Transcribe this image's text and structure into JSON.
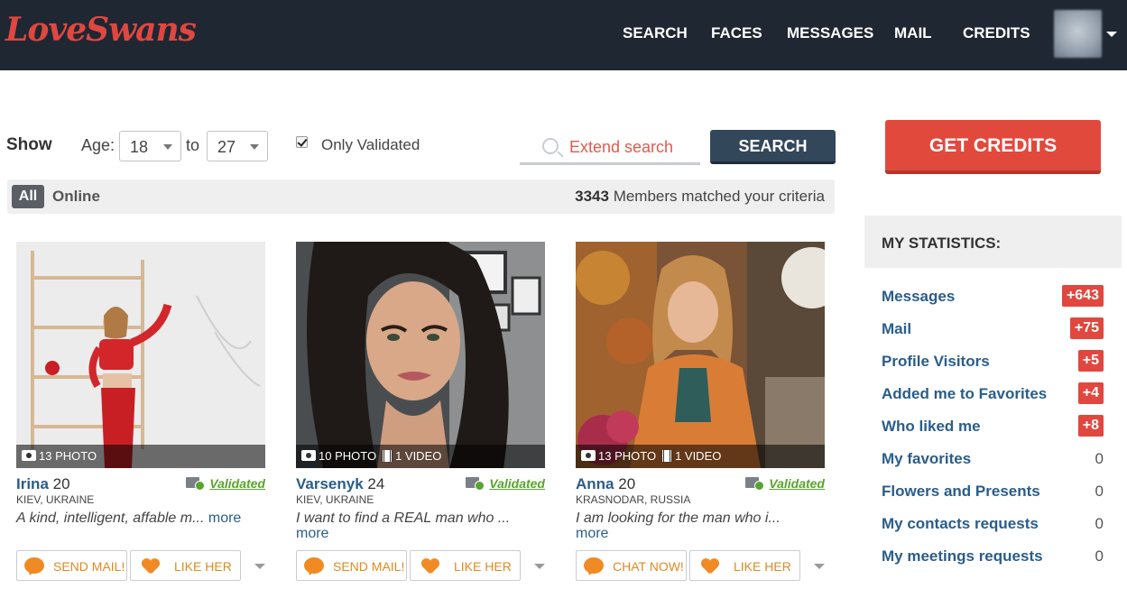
{
  "header": {
    "logo": "LoveSwans",
    "nav": [
      "SEARCH",
      "FACES",
      "MESSAGES",
      "MAIL",
      "CREDITS"
    ]
  },
  "filters": {
    "show_label": "Show",
    "age_label": "Age:",
    "age_from": "18",
    "to_label": "to",
    "age_to": "27",
    "only_validated_label": "Only Validated",
    "only_validated_checked": true,
    "extend_search": "Extend search",
    "search_button": "SEARCH"
  },
  "tabs": {
    "all": "All",
    "online": "Online",
    "count": "3343",
    "matched_text": "Members matched your criteria"
  },
  "profiles": [
    {
      "name": "Irina",
      "age": "20",
      "location": "KIEV, UKRAINE",
      "validated": "Validated",
      "media": "13 PHOTO",
      "video": "",
      "description": "A kind, intelligent, affable m...",
      "more": "more",
      "primary_action": "SEND MAIL!",
      "like_action": "LIKE HER"
    },
    {
      "name": "Varsenyk",
      "age": "24",
      "location": "KIEV, UKRAINE",
      "validated": "Validated",
      "media": "10 PHOTO",
      "video": "1 VIDEO",
      "description": "I want to find a REAL man who ...",
      "more": "more",
      "primary_action": "SEND MAIL!",
      "like_action": "LIKE HER"
    },
    {
      "name": "Anna",
      "age": "20",
      "location": "KRASNODAR, RUSSIA",
      "validated": "Validated",
      "media": "13 PHOTO",
      "video": "1 VIDEO",
      "description": "I am looking for the man who i...",
      "more": "more",
      "primary_action": "CHAT NOW!",
      "like_action": "LIKE HER"
    }
  ],
  "sidebar": {
    "get_credits": "GET CREDITS",
    "stats_title": "MY STATISTICS:",
    "stats": [
      {
        "label": "Messages",
        "value": "+643",
        "highlight": true
      },
      {
        "label": "Mail",
        "value": "+75",
        "highlight": true
      },
      {
        "label": "Profile Visitors",
        "value": "+5",
        "highlight": true
      },
      {
        "label": "Added me to Favorites",
        "value": "+4",
        "highlight": true
      },
      {
        "label": "Who liked me",
        "value": "+8",
        "highlight": true
      },
      {
        "label": "My favorites",
        "value": "0",
        "highlight": false
      },
      {
        "label": "Flowers and Presents",
        "value": "0",
        "highlight": false
      },
      {
        "label": "My contacts requests",
        "value": "0",
        "highlight": false
      },
      {
        "label": "My meetings requests",
        "value": "0",
        "highlight": false
      }
    ]
  },
  "colors": {
    "header_bg": "#1f2733",
    "accent_red": "#e2493d",
    "link_blue": "#2a5d8a",
    "validated_green": "#59a52c",
    "action_orange": "#e08a1e"
  }
}
